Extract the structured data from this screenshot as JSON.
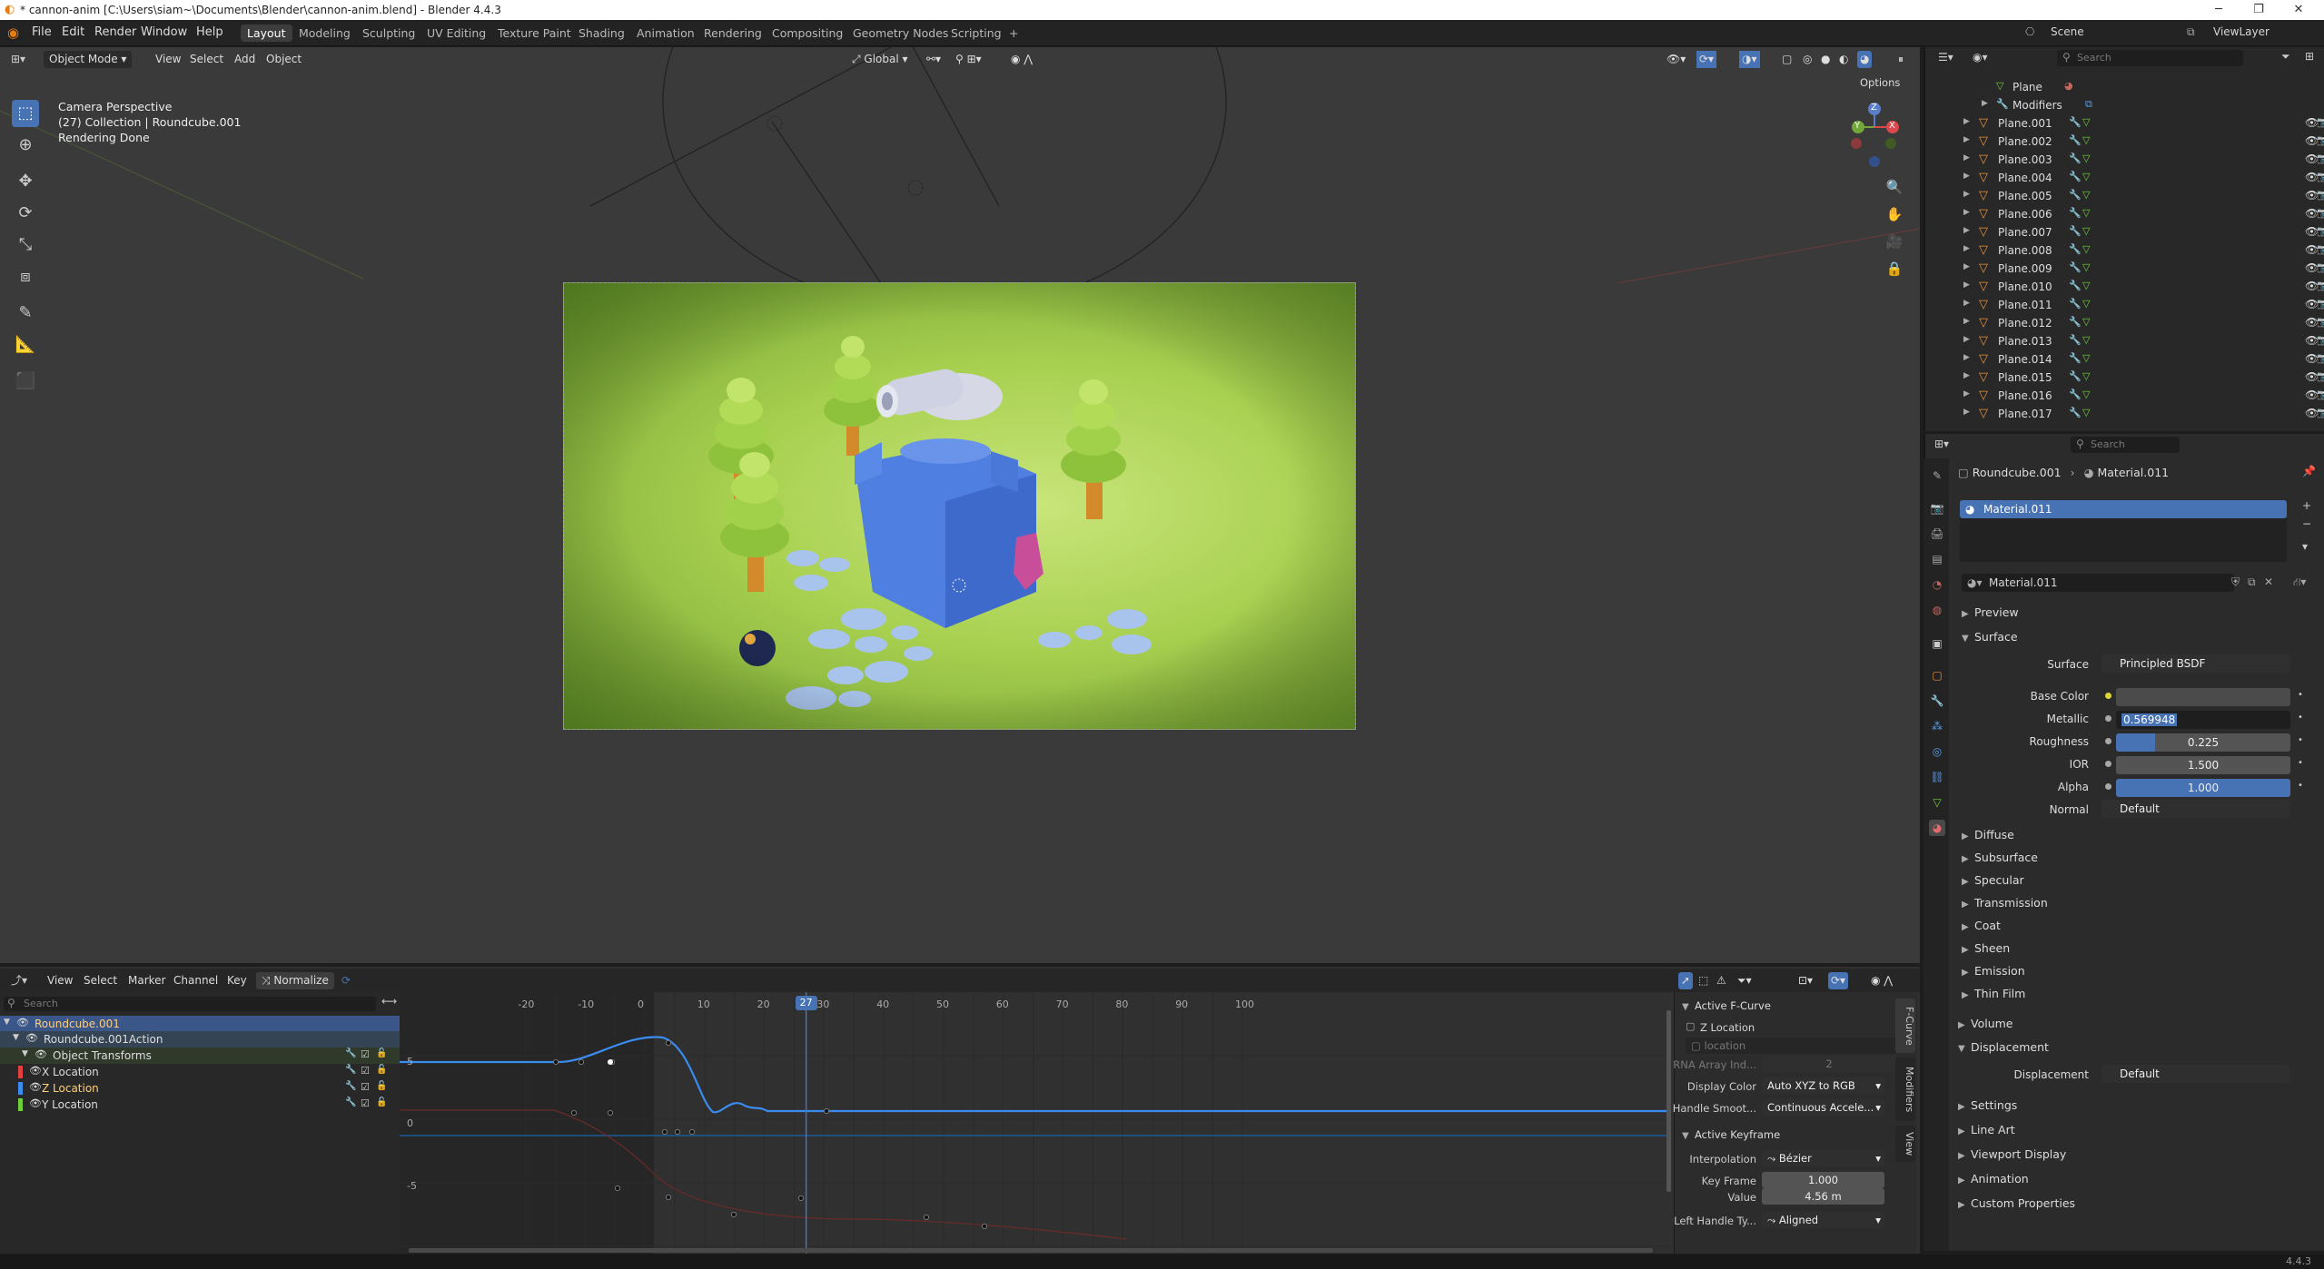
{
  "window": {
    "title": "* cannon-anim [C:\\Users\\siam~\\Documents\\Blender\\cannon-anim.blend] - Blender 4.4.3"
  },
  "menus": [
    "File",
    "Edit",
    "Render",
    "Window",
    "Help"
  ],
  "workspaces": [
    "Layout",
    "Modeling",
    "Sculpting",
    "UV Editing",
    "Texture Paint",
    "Shading",
    "Animation",
    "Rendering",
    "Compositing",
    "Geometry Nodes",
    "Scripting",
    "+"
  ],
  "topright": {
    "scene": "Scene",
    "viewlayer": "ViewLayer"
  },
  "viewport": {
    "mode": "Object Mode",
    "menu": [
      "View",
      "Select",
      "Add",
      "Object"
    ],
    "orientation": "Global",
    "options": "Options",
    "info_line1": "Camera Perspective",
    "info_line2": "(27) Collection | Roundcube.001",
    "info_line3": "Rendering Done",
    "gizmo": {
      "x": "X",
      "y": "Y",
      "z": "Z"
    }
  },
  "outliner": {
    "search_placeholder": "Search",
    "items": [
      {
        "name": "Plane",
        "kind": "mesh"
      },
      {
        "name": "Modifiers",
        "kind": "modifiers"
      },
      {
        "name": "Plane.001",
        "kind": "object"
      },
      {
        "name": "Plane.002",
        "kind": "object"
      },
      {
        "name": "Plane.003",
        "kind": "object"
      },
      {
        "name": "Plane.004",
        "kind": "object"
      },
      {
        "name": "Plane.005",
        "kind": "object"
      },
      {
        "name": "Plane.006",
        "kind": "object"
      },
      {
        "name": "Plane.007",
        "kind": "object"
      },
      {
        "name": "Plane.008",
        "kind": "object"
      },
      {
        "name": "Plane.009",
        "kind": "object"
      },
      {
        "name": "Plane.010",
        "kind": "object"
      },
      {
        "name": "Plane.011",
        "kind": "object"
      },
      {
        "name": "Plane.012",
        "kind": "object"
      },
      {
        "name": "Plane.013",
        "kind": "object"
      },
      {
        "name": "Plane.014",
        "kind": "object"
      },
      {
        "name": "Plane.015",
        "kind": "object"
      },
      {
        "name": "Plane.016",
        "kind": "object"
      },
      {
        "name": "Plane.017",
        "kind": "object"
      }
    ]
  },
  "properties": {
    "search_placeholder": "Search",
    "breadcrumb_object": "Roundcube.001",
    "breadcrumb_material": "Material.011",
    "slot": "Material.011",
    "material_name": "Material.011",
    "sections": {
      "preview": "Preview",
      "surface": "Surface",
      "diffuse": "Diffuse",
      "subsurface": "Subsurface",
      "specular": "Specular",
      "transmission": "Transmission",
      "coat": "Coat",
      "sheen": "Sheen",
      "emission": "Emission",
      "thin_film": "Thin Film",
      "volume": "Volume",
      "displacement": "Displacement",
      "settings": "Settings",
      "line_art": "Line Art",
      "viewport_display": "Viewport Display",
      "animation": "Animation",
      "custom_properties": "Custom Properties"
    },
    "surface_label": "Surface",
    "surface_value": "Principled BSDF",
    "base_color_label": "Base Color",
    "metallic_label": "Metallic",
    "metallic_value": "0.569948",
    "roughness_label": "Roughness",
    "roughness_value": "0.225",
    "roughness_fraction": 0.225,
    "ior_label": "IOR",
    "ior_value": "1.500",
    "alpha_label": "Alpha",
    "alpha_value": "1.000",
    "normal_label": "Normal",
    "normal_value": "Default",
    "displacement_label": "Displacement",
    "displacement_value": "Default"
  },
  "graph_editor": {
    "menu": [
      "View",
      "Select",
      "Marker",
      "Channel",
      "Key"
    ],
    "normalize": "Normalize",
    "search_placeholder": "Search",
    "current_frame": "27",
    "frame_ticks": [
      "-20",
      "-10",
      "0",
      "10",
      "20",
      "30",
      "40",
      "50",
      "60",
      "70",
      "80",
      "90",
      "100"
    ],
    "value_ticks": [
      "5",
      "0",
      "-5"
    ],
    "channels": [
      {
        "label": "Roundcube.001",
        "level": 0
      },
      {
        "label": "Roundcube.001Action",
        "level": 1
      },
      {
        "label": "Object Transforms",
        "level": 2
      },
      {
        "label": "X Location",
        "level": 3,
        "color": "#e04040"
      },
      {
        "label": "Z Location",
        "level": 3,
        "color": "#3a8cf0"
      },
      {
        "label": "Y Location",
        "level": 3,
        "color": "#6fcf3a"
      }
    ],
    "npanel": {
      "active_fcurve": "Active F-Curve",
      "fcurve_name": "Z Location",
      "path": "location",
      "rna_label": "RNA Array Ind...",
      "rna_value": "2",
      "display_color_label": "Display Color",
      "display_color_value": "Auto XYZ to RGB",
      "handle_smooth_label": "Handle Smoot...",
      "handle_smooth_value": "Continuous Accele...",
      "active_keyframe": "Active Keyframe",
      "interpolation_label": "Interpolation",
      "interpolation_value": "Bézier",
      "key_frame_label": "Key Frame",
      "key_frame_value": "1.000",
      "value_label": "Value",
      "value_value": "4.56 m",
      "left_handle_label": "Left Handle Ty...",
      "left_handle_value": "Aligned",
      "tabs": [
        "F-Curve",
        "Modifiers",
        "View"
      ]
    }
  },
  "status": {
    "version": "4.4.3"
  },
  "colors": {
    "accent": "#4772b3",
    "x_axis": "#e04040",
    "y_axis": "#6fcf3a",
    "z_axis": "#3a8cf0",
    "object_orange": "#e8913a"
  }
}
